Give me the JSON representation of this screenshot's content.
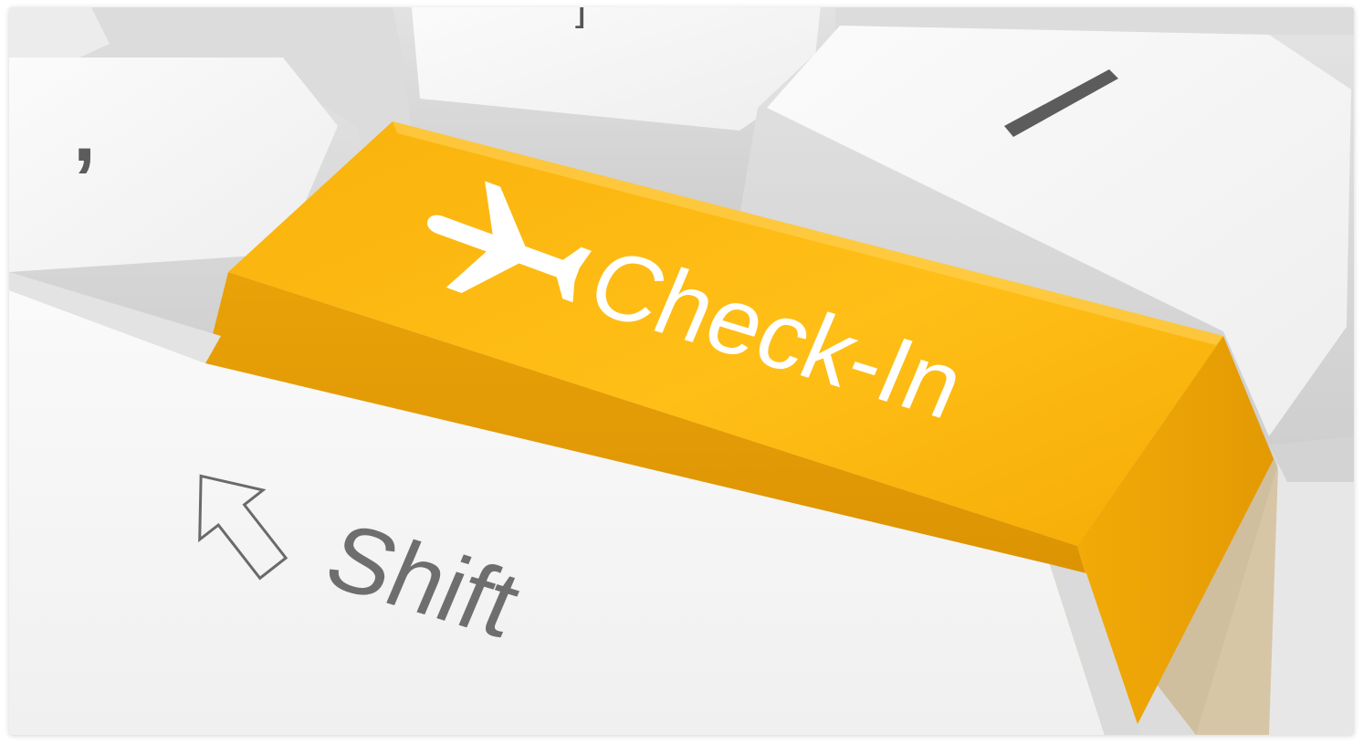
{
  "keys": {
    "comma": {
      "legend": ","
    },
    "bracket": {
      "legend": "]"
    },
    "slash": {
      "legend": "/"
    },
    "checkin": {
      "legend": "Check-In",
      "icon": "airplane-icon"
    },
    "shift": {
      "legend": "Shift",
      "icon": "shift-arrow-icon"
    }
  },
  "colors": {
    "checkin_top": "#FDB713",
    "checkin_side": "#E59F05",
    "white_key": "#F4F4F4",
    "legend_gray": "#6E6E6E",
    "legend_white": "#FFFFFF"
  }
}
